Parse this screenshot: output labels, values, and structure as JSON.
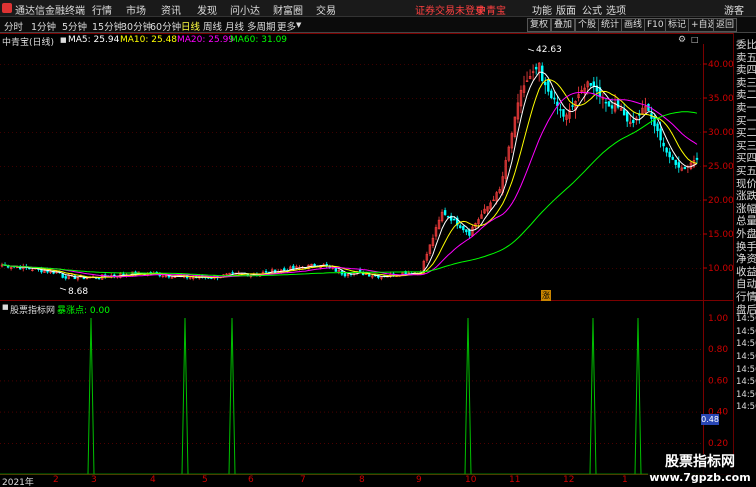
{
  "app": {
    "title": "通达信金融终端",
    "menus": [
      "行情",
      "市场",
      "资讯",
      "发现",
      "问小达",
      "财富圈",
      "交易"
    ],
    "login_status": "证券交易未登录",
    "stock_link": "中青宝",
    "right_menus": [
      "功能",
      "版面",
      "公式",
      "选项"
    ],
    "user": "游客"
  },
  "toolbar": {
    "periods": [
      "分时",
      "1分钟",
      "5分钟",
      "15分钟",
      "30分钟",
      "60分钟",
      "日线",
      "周线",
      "月线",
      "多周期",
      "更多"
    ],
    "active_period": "日线",
    "buttons": [
      "复权",
      "叠加",
      "个股",
      "统计",
      "画线",
      "F10",
      "标记",
      "+自选",
      "返回"
    ]
  },
  "kline": {
    "stock_label": "中青宝(日线)",
    "ma5": "MA5: 25.94",
    "ma10": "MA10: 25.48",
    "ma20": "MA20: 25.99",
    "ma60": "MA60: 31.09",
    "high_label": "42.63",
    "low_label": "8.68",
    "marker": "涨",
    "y_ticks": [
      "40.00",
      "35.00",
      "30.00",
      "25.00",
      "20.00",
      "15.00",
      "10.00"
    ],
    "colors": {
      "up": "#ff4040",
      "down": "#00ffff",
      "ma5": "#ffffff",
      "ma10": "#ffff00",
      "ma20": "#ff00ff",
      "ma60": "#00ff00",
      "grid": "#7a0000"
    }
  },
  "indicator": {
    "title": "股票指标网",
    "line_label": "暴涨点: 0.00",
    "y_ticks": [
      "1.00",
      "0.80",
      "0.60",
      "0.40",
      "0.20"
    ],
    "current_value": "0.48",
    "spikes": [
      {
        "month": "3",
        "value": 1.0
      },
      {
        "month": "5",
        "value": 1.0
      },
      {
        "month": "5",
        "value": 1.0
      },
      {
        "month": "9",
        "value": 1.0
      },
      {
        "month": "12",
        "value": 1.0
      },
      {
        "month": "1",
        "value": 1.0
      }
    ]
  },
  "time_axis": {
    "labels": [
      "2021年",
      "2",
      "3",
      "4",
      "5",
      "6",
      "7",
      "8",
      "9",
      "10",
      "11",
      "12",
      "1"
    ]
  },
  "right_panel": {
    "labels": [
      "委比",
      "卖五",
      "卖四",
      "卖三",
      "卖二",
      "卖一",
      "买一",
      "买二",
      "买三",
      "买四",
      "买五",
      "现价",
      "涨跌",
      "涨幅",
      "总量",
      "外盘",
      "换手",
      "净资",
      "收益",
      "自动",
      "行情",
      "盘后",
      "14:50",
      "14:50",
      "14:50",
      "14:50",
      "14:50",
      "14:50",
      "14:50",
      "14:50"
    ]
  },
  "watermark": {
    "line1": "股票指标网",
    "line2": "www.7gpzb.com"
  }
}
